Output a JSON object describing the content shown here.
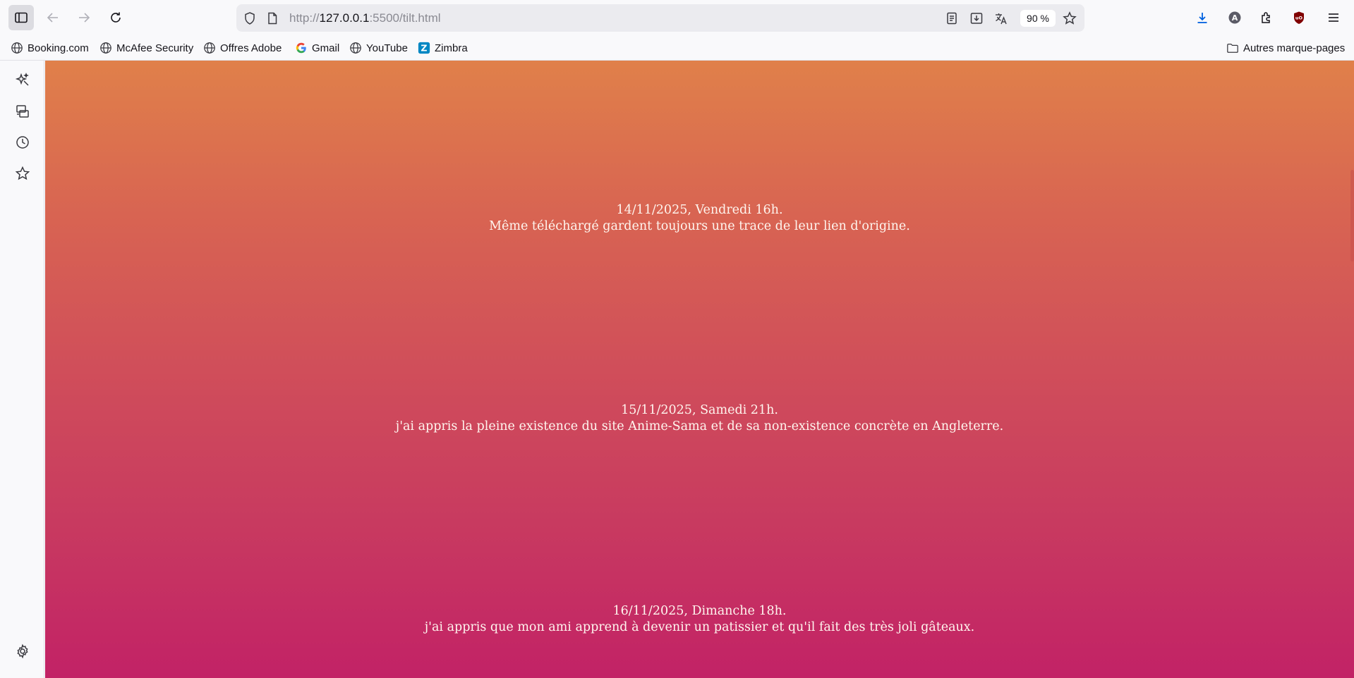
{
  "browser": {
    "url_prefix": "http://",
    "url_host": "127.0.0.1",
    "url_rest": ":5500/tilt.html",
    "zoom": "90 %"
  },
  "bookmarks": [
    {
      "label": "Booking.com",
      "icon": "globe-icon"
    },
    {
      "label": "McAfee Security",
      "icon": "globe-icon"
    },
    {
      "label": "Offres Adobe",
      "icon": "globe-icon"
    },
    {
      "label": "Gmail",
      "icon": "google-icon"
    },
    {
      "label": "YouTube",
      "icon": "globe-icon"
    },
    {
      "label": "Zimbra",
      "icon": "zimbra-icon"
    }
  ],
  "other_bookmarks": "Autres marque-pages",
  "entries": [
    {
      "date": "14/11/2025, Vendredi 16h.",
      "text": "Même téléchargé gardent toujours une trace de leur lien d'origine."
    },
    {
      "date": "15/11/2025, Samedi 21h.",
      "text": "j'ai appris la pleine existence du site Anime-Sama et de sa non-existence concrète en Angleterre."
    },
    {
      "date": "16/11/2025, Dimanche 18h.",
      "text": "j'ai appris que mon ami apprend à devenir un patissier et qu'il fait des très joli gâteaux."
    }
  ],
  "colors": {
    "gradient_top": "#e0804a",
    "gradient_bottom": "#c22266",
    "ublock": "#800000",
    "download_blue": "#0061e0"
  }
}
